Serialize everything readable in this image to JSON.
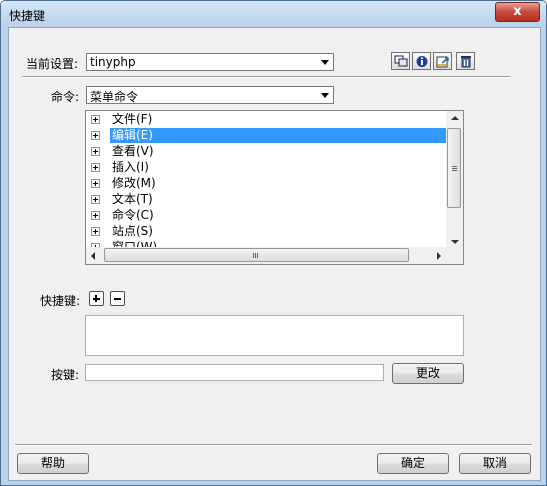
{
  "window": {
    "title": "快捷键",
    "close_label": "x"
  },
  "settings": {
    "label": "当前设置:",
    "value": "tinyphp"
  },
  "toolbar": {
    "icons": [
      "duplicate-set-icon",
      "rename-set-icon",
      "export-set-icon",
      "delete-set-icon"
    ]
  },
  "commands": {
    "label": "命令:",
    "value": "菜单命令",
    "tree_items": [
      {
        "label": "文件(F)",
        "selected": false
      },
      {
        "label": "编辑(E)",
        "selected": true
      },
      {
        "label": "查看(V)",
        "selected": false
      },
      {
        "label": "插入(I)",
        "selected": false
      },
      {
        "label": "修改(M)",
        "selected": false
      },
      {
        "label": "文本(T)",
        "selected": false
      },
      {
        "label": "命令(C)",
        "selected": false
      },
      {
        "label": "站点(S)",
        "selected": false
      },
      {
        "label": "窗口(W)",
        "selected": false
      }
    ]
  },
  "shortcuts": {
    "label": "快捷键:",
    "add_symbol": "+",
    "remove_symbol": "−"
  },
  "keypress": {
    "label": "按键:",
    "value": "",
    "change_label": "更改"
  },
  "footer": {
    "help_label": "帮助",
    "ok_label": "确定",
    "cancel_label": "取消"
  },
  "colors": {
    "selection": "#3399ff",
    "client_bg": "#f0f0f0",
    "frame": "#bcd3ea",
    "close_button": "#c7483a"
  }
}
